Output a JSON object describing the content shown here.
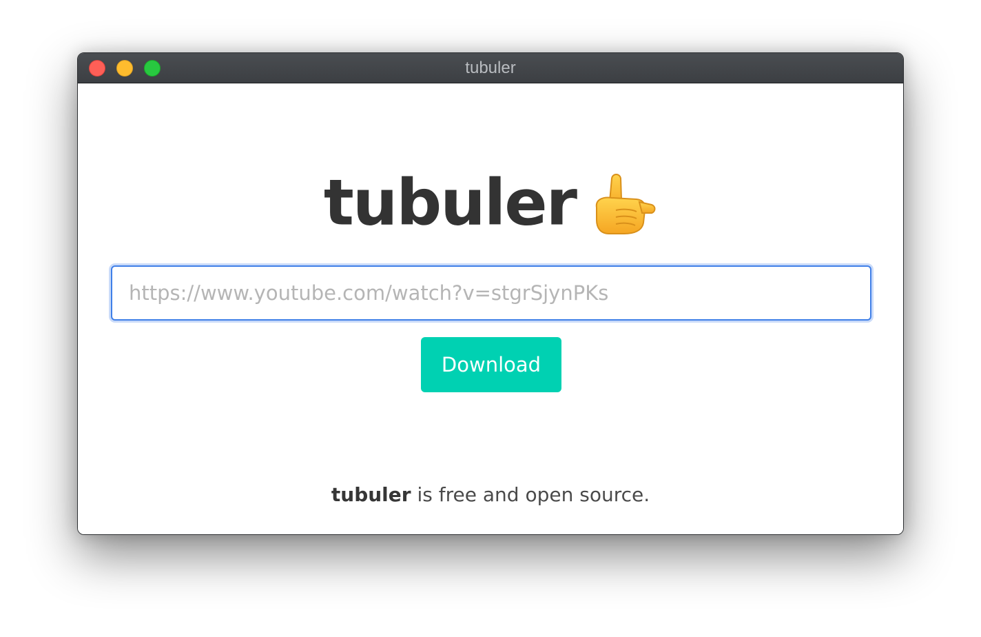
{
  "window": {
    "title": "tubuler"
  },
  "main": {
    "heading": "tubuler",
    "heading_icon": "call-me-hand-emoji",
    "url_input": {
      "placeholder": "https://www.youtube.com/watch?v=stgrSjynPKs",
      "value": ""
    },
    "download_label": "Download",
    "footer_app_name": "tubuler",
    "footer_text": " is free and open source."
  },
  "colors": {
    "titlebar": "#3f4246",
    "close": "#fe5f57",
    "minimize": "#febc2e",
    "maximize": "#28c840",
    "accent_button": "#00d1b2",
    "input_focus": "#3f7fe8",
    "text_dark": "#333333"
  }
}
